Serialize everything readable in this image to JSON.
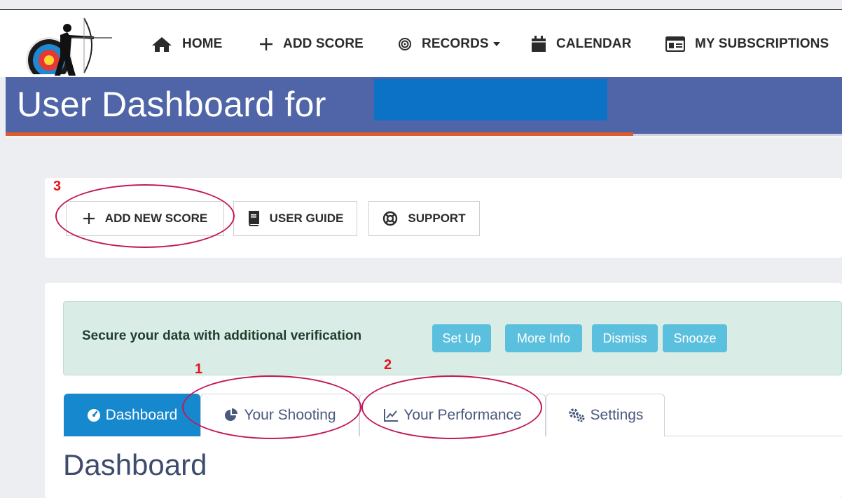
{
  "nav": {
    "items": [
      {
        "label": "HOME",
        "icon": "home-icon"
      },
      {
        "label": "ADD SCORE",
        "icon": "plus-icon"
      },
      {
        "label": "RECORDS",
        "icon": "target-icon",
        "has_dropdown": true
      },
      {
        "label": "CALENDAR",
        "icon": "calendar-icon"
      },
      {
        "label": "MY SUBSCRIPTIONS",
        "icon": "id-card-icon"
      }
    ]
  },
  "header": {
    "title": "User Dashboard for",
    "redacted_color": "#0b72c6",
    "band_color": "#4f65a8",
    "accent_color": "#e25a2b"
  },
  "actions": {
    "add_new_score": "ADD NEW SCORE",
    "user_guide": "USER GUIDE",
    "support": "SUPPORT"
  },
  "alert": {
    "text": "Secure your data with additional verification",
    "buttons": [
      "Set Up",
      "More Info",
      "Dismiss",
      "Snooze"
    ],
    "button_color": "#5bc0de"
  },
  "tabs": [
    {
      "label": "Dashboard",
      "icon": "gauge-icon",
      "active": true
    },
    {
      "label": "Your Shooting",
      "icon": "pie-chart-icon",
      "active": false
    },
    {
      "label": "Your Performance",
      "icon": "line-chart-icon",
      "active": false
    },
    {
      "label": "Settings",
      "icon": "cogs-icon",
      "active": false
    }
  ],
  "main": {
    "heading": "Dashboard"
  },
  "annotations": {
    "labels": [
      "1",
      "2",
      "3"
    ],
    "color": "#e0141e"
  }
}
